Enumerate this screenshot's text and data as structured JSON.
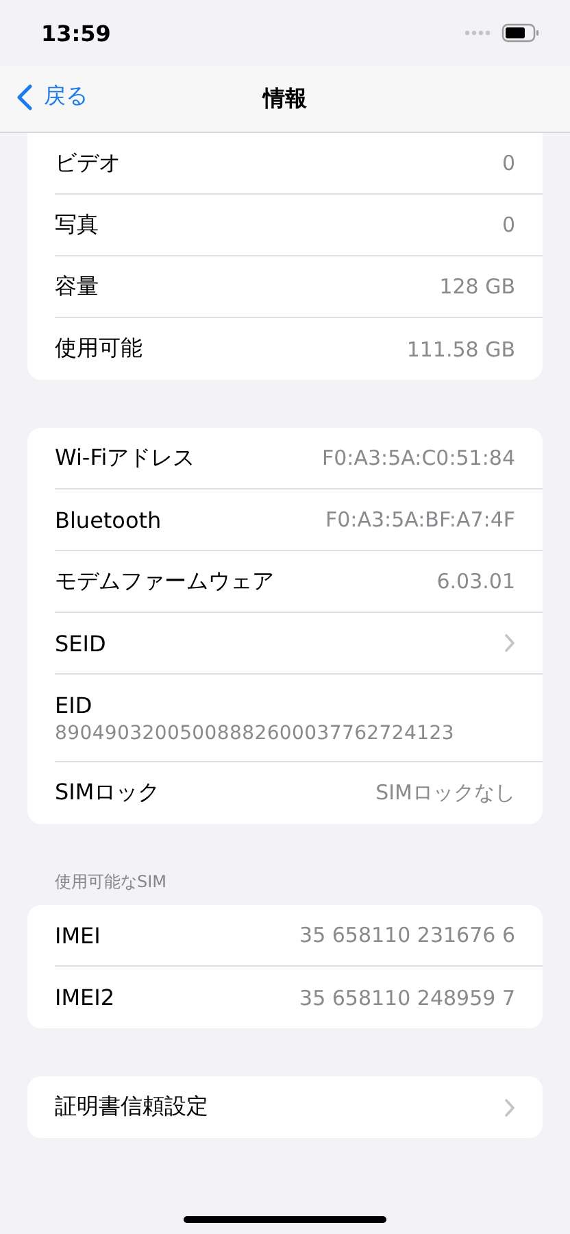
{
  "status_bar": {
    "time": "13:59"
  },
  "nav": {
    "back": "戻る",
    "title": "情報"
  },
  "groups": [
    {
      "cut_top": true,
      "rows": [
        {
          "kind": "value",
          "label": "ビデオ",
          "value": "0"
        },
        {
          "kind": "value",
          "label": "写真",
          "value": "0"
        },
        {
          "kind": "value",
          "label": "容量",
          "value": "128 GB"
        },
        {
          "kind": "value",
          "label": "使用可能",
          "value": "111.58 GB"
        }
      ]
    },
    {
      "cut_top": false,
      "rows": [
        {
          "kind": "value",
          "label": "Wi-Fiアドレス",
          "value": "F0:A3:5A:C0:51:84"
        },
        {
          "kind": "value",
          "label": "Bluetooth",
          "value": "F0:A3:5A:BF:A7:4F"
        },
        {
          "kind": "value",
          "label": "モデムファームウェア",
          "value": "6.03.01"
        },
        {
          "kind": "link",
          "label": "SEID"
        },
        {
          "kind": "stacked",
          "label": "EID",
          "value": "89049032005008882600037762724123"
        },
        {
          "kind": "value",
          "label": "SIMロック",
          "value": "SIMロックなし"
        }
      ]
    },
    {
      "cut_top": false,
      "header": "使用可能なSIM",
      "rows": [
        {
          "kind": "value",
          "label": "IMEI",
          "value": "35 658110 231676 6"
        },
        {
          "kind": "value",
          "label": "IMEI2",
          "value": "35 658110 248959 7"
        }
      ]
    },
    {
      "cut_top": false,
      "rows": [
        {
          "kind": "link",
          "label": "証明書信頼設定"
        }
      ]
    }
  ]
}
